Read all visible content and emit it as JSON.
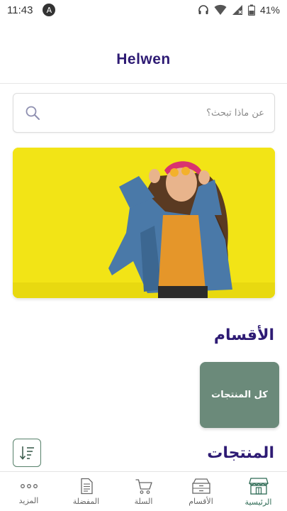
{
  "status_bar": {
    "time": "11:43",
    "app_badge": "A",
    "battery": "41%"
  },
  "app_bar": {
    "title": "Helwen"
  },
  "search": {
    "placeholder": "عن ماذا تبحث؟"
  },
  "banner": {
    "background_color": "#f2e416"
  },
  "sections": {
    "categories_title": "الأقسام",
    "products_title": "المنتجات"
  },
  "categories": [
    {
      "label": "كل المنتجات",
      "color": "#6b8a7a"
    }
  ],
  "bottom_nav": {
    "active": "home",
    "items": [
      {
        "label": "المزيد",
        "icon": "more-dots-icon"
      },
      {
        "label": "المفضلة",
        "icon": "document-icon"
      },
      {
        "label": "السلة",
        "icon": "cart-icon"
      },
      {
        "label": "الأقسام",
        "icon": "archive-box-icon"
      },
      {
        "label": "الرئيسية",
        "icon": "store-icon"
      }
    ]
  },
  "colors": {
    "brand": "#2e1b74",
    "accent": "#56806a"
  }
}
